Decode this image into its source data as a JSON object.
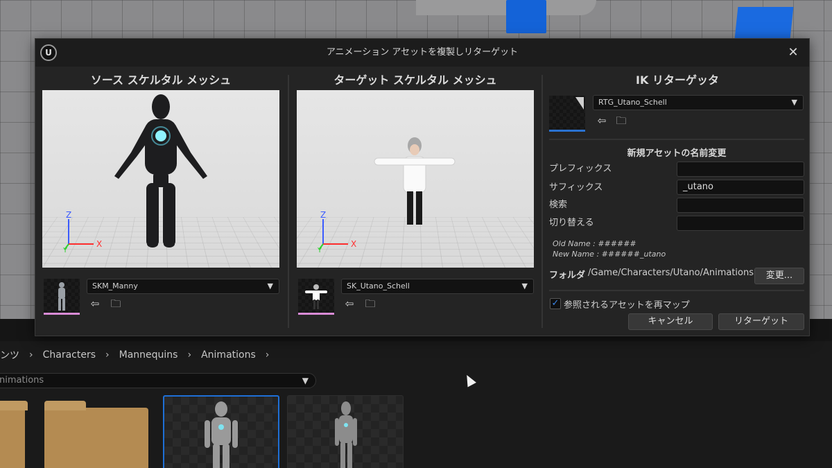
{
  "dialog": {
    "title": "アニメーション アセットを複製しリターゲット",
    "close_symbol": "✕"
  },
  "source": {
    "heading": "ソース スケルタル メッシュ",
    "mesh": "SKM_Manny"
  },
  "target": {
    "heading": "ターゲット スケルタル メッシュ",
    "mesh": "SK_Utano_Schell"
  },
  "axes": {
    "z": "Z",
    "y": "Y",
    "x": "X"
  },
  "retargeter": {
    "heading": "IK リターゲッタ",
    "asset": "RTG_Utano_Schell"
  },
  "rename": {
    "heading": "新規アセットの名前変更",
    "prefix_label": "プレフィックス",
    "prefix_value": "",
    "suffix_label": "サフィックス",
    "suffix_value": "_utano",
    "search_label": "検索",
    "search_value": "",
    "replace_label": "切り替える",
    "replace_value": "",
    "old_name": "Old Name : ######",
    "new_name": "New Name : ######_utano"
  },
  "folder": {
    "label": "フォルダ",
    "path": "/Game/Characters/Utano/Animations",
    "change_button": "変更..."
  },
  "remap": {
    "label": "参照されるアセットを再マップ",
    "checked": true
  },
  "actions": {
    "cancel": "キャンセル",
    "retarget": "リターゲット"
  },
  "content_browser": {
    "breadcrumb": [
      "ンツ",
      "Characters",
      "Mannequins",
      "Animations"
    ],
    "path_value": "nimations"
  },
  "icons": {
    "use_selected": "arrow-left-circle-icon",
    "browse": "folder-search-icon"
  }
}
